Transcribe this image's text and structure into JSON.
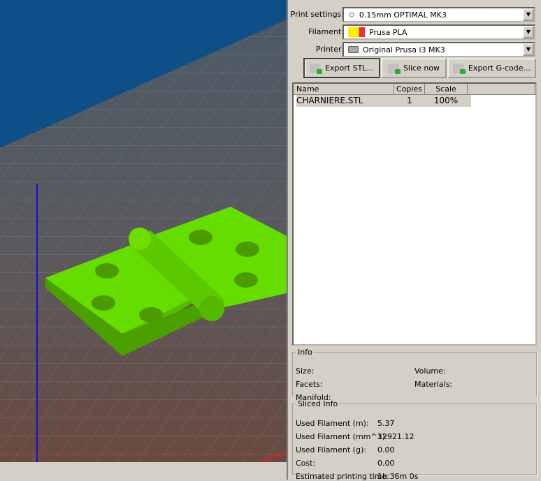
{
  "settings": {
    "print_label": "Print settings:",
    "print_value": "0.15mm OPTIMAL MK3",
    "filament_label": "Filament:",
    "filament_value": "Prusa PLA",
    "filament_colors": [
      "#ffee00",
      "#e83030"
    ],
    "printer_label": "Printer:",
    "printer_value": "Original Prusa i3 MK3"
  },
  "buttons": {
    "export_stl": "Export STL...",
    "slice": "Slice now",
    "export_gcode": "Export G-code..."
  },
  "list": {
    "headers": [
      "Name",
      "Copies",
      "Scale"
    ],
    "rows": [
      {
        "name": "CHARNIERE.STL",
        "copies": "1",
        "scale": "100%"
      }
    ]
  },
  "info": {
    "title": "Info",
    "size": "Size:",
    "volume": "Volume:",
    "facets": "Facets:",
    "materials": "Materials:",
    "manifold": "Manifold:"
  },
  "sliced": {
    "title": "Sliced Info",
    "items": [
      {
        "label": "Used Filament (m):",
        "value": "5.37"
      },
      {
        "label": "Used Filament (mm^3):",
        "value": "12921.12"
      },
      {
        "label": "Used Filament (g):",
        "value": "0.00"
      },
      {
        "label": "Cost:",
        "value": "0.00"
      },
      {
        "label": "Estimated printing time:",
        "value": "1h 36m 0s"
      }
    ]
  },
  "colors": {
    "model": "#66dd00",
    "background": "#0d4f86"
  }
}
